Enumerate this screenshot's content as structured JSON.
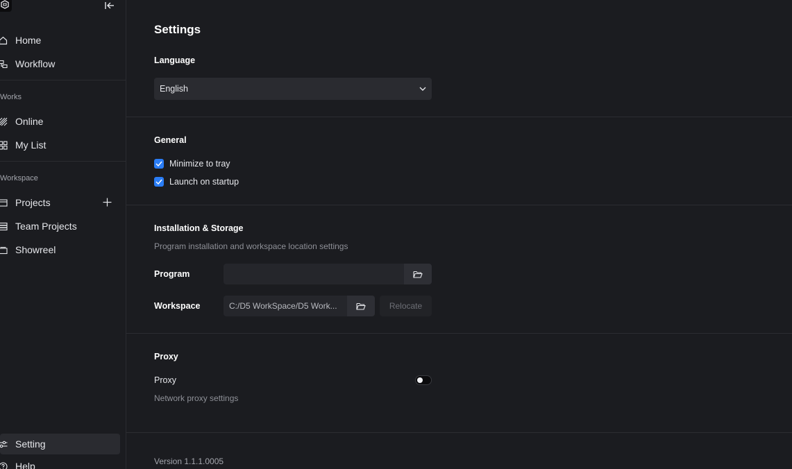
{
  "sidebar": {
    "nav": [
      {
        "label": "Home",
        "icon": "home-icon"
      },
      {
        "label": "Workflow",
        "icon": "workflow-icon"
      }
    ],
    "works_label": "Works",
    "works": [
      {
        "label": "Online",
        "icon": "online-icon"
      },
      {
        "label": "My List",
        "icon": "grid-icon"
      }
    ],
    "workspace_label": "Workspace",
    "workspace": [
      {
        "label": "Projects",
        "icon": "folder-icon"
      },
      {
        "label": "Team Projects",
        "icon": "stack-icon"
      },
      {
        "label": "Showreel",
        "icon": "showreel-icon"
      }
    ],
    "bottom": [
      {
        "label": "Setting",
        "icon": "sliders-icon",
        "active": true
      },
      {
        "label": "Help",
        "icon": "help-icon"
      }
    ]
  },
  "settings": {
    "title": "Settings",
    "language": {
      "heading": "Language",
      "selected": "English"
    },
    "general": {
      "heading": "General",
      "options": [
        {
          "label": "Minimize to tray",
          "checked": true
        },
        {
          "label": "Launch on startup",
          "checked": true
        }
      ]
    },
    "storage": {
      "heading": "Installation & Storage",
      "description": "Program installation and workspace location settings",
      "program_label": "Program",
      "program_value": "",
      "workspace_label": "Workspace",
      "workspace_value": "C:/D5 WorkSpace/D5 Work...",
      "relocate_label": "Relocate"
    },
    "proxy": {
      "heading": "Proxy",
      "label": "Proxy",
      "description": "Network proxy settings",
      "enabled": false
    },
    "version": "Version 1.1.1.0005"
  },
  "colors": {
    "accent": "#2a7df6",
    "background": "#1b1c20",
    "panel": "#2a2b30"
  }
}
